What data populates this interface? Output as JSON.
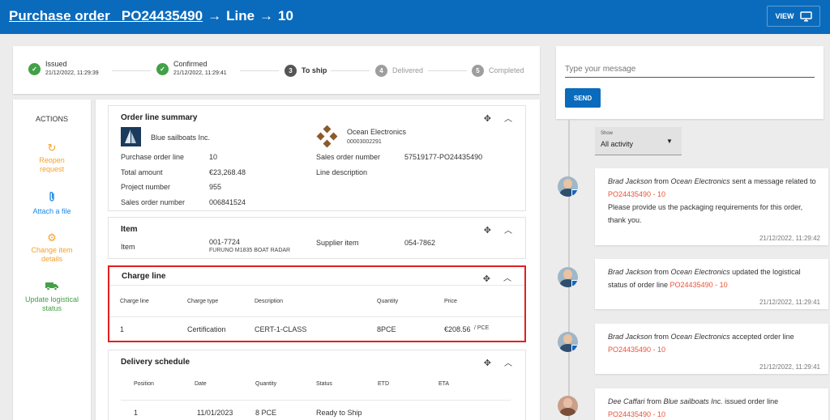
{
  "header": {
    "title_link": "Purchase order   PO24435490",
    "arrow1": "→",
    "line_label": "Line",
    "arrow2": "→",
    "line_number": "10",
    "view_label": "VIEW"
  },
  "steps": [
    {
      "num": "✓",
      "label": "Issued",
      "date": "21/12/2022, 11:29:39",
      "state": "done"
    },
    {
      "num": "✓",
      "label": "Confirmed",
      "date": "21/12/2022, 11:29:41",
      "state": "done"
    },
    {
      "num": "3",
      "label": "To ship",
      "date": "",
      "state": "current"
    },
    {
      "num": "4",
      "label": "Delivered",
      "date": "",
      "state": "todo"
    },
    {
      "num": "5",
      "label": "Completed",
      "date": "",
      "state": "todo"
    }
  ],
  "actions": {
    "title": "ACTIONS",
    "items": [
      {
        "label": "Reopen request",
        "icon": "refresh-icon"
      },
      {
        "label": "Attach a file",
        "icon": "paperclip-icon"
      },
      {
        "label": "Change item details",
        "icon": "gear-icon"
      },
      {
        "label": "Update logistical status",
        "icon": "truck-icon"
      }
    ]
  },
  "summary": {
    "title": "Order line summary",
    "buyer": "Blue sailboats Inc.",
    "supplier": "Ocean Electronics",
    "supplier_id": "00003002291",
    "left": [
      {
        "label": "Purchase order line",
        "value": "10"
      },
      {
        "label": "Total amount",
        "value": "€23,268.48"
      },
      {
        "label": "Project number",
        "value": "955"
      },
      {
        "label": "Sales order number",
        "value": "006841524"
      }
    ],
    "right": [
      {
        "label": "Sales order number",
        "value": "57519177-PO24435490"
      },
      {
        "label": "Line description",
        "value": ""
      }
    ]
  },
  "item": {
    "title": "Item",
    "label": "Item",
    "code": "001-7724",
    "desc": "FURUNO M1835 BOAT RADAR",
    "supplier_label": "Supplier item",
    "supplier_value": "054-7862"
  },
  "charge": {
    "title": "Charge line",
    "headers": [
      "Charge line",
      "Charge type",
      "Description",
      "Quantity",
      "Price"
    ],
    "row": {
      "line": "1",
      "type": "Certification",
      "desc": "CERT-1-CLASS",
      "qty": "8PCE",
      "price": "€208.56",
      "unit": "/ PCE"
    }
  },
  "delivery": {
    "title": "Delivery schedule",
    "headers": [
      "Position",
      "Date",
      "Quantity",
      "Status",
      "ETD",
      "ETA"
    ],
    "row": {
      "pos": "1",
      "date": "11/01/2023",
      "qty": "8 PCE",
      "status": "Ready to Ship",
      "etd": "",
      "eta": ""
    }
  },
  "chat": {
    "placeholder": "Type your message",
    "send": "SEND"
  },
  "filter": {
    "label": "Show",
    "value": "All activity"
  },
  "events": [
    {
      "who": "Brad Jackson",
      "mid1": " from ",
      "org": "Ocean Electronics",
      "mid2": " sent a message related to ",
      "link": "PO24435490 - 10",
      "extra": "Please provide us the packaging requirements for this order, thank you.",
      "time": "21/12/2022, 11:29:42"
    },
    {
      "who": "Brad Jackson",
      "mid1": " from ",
      "org": "Ocean Electronics",
      "mid2": " updated the logistical status of order line ",
      "link": "PO24435490 - 10",
      "extra": "",
      "time": "21/12/2022, 11:29:41"
    },
    {
      "who": "Brad Jackson",
      "mid1": " from ",
      "org": "Ocean Electronics",
      "mid2": " accepted order line ",
      "link": "PO24435490 - 10",
      "extra": "",
      "time": "21/12/2022, 11:29:41"
    },
    {
      "who": "Dee Caffari",
      "mid1": " from ",
      "org": "Blue sailboats Inc.",
      "mid2": " issued order line ",
      "link": "PO24435490 - 10",
      "extra": "",
      "time": ""
    }
  ],
  "colors": {
    "header_bg": "#0a6bbd",
    "accent": "#0a6bbd",
    "highlight": "#e02020",
    "link": "#e8533a",
    "done": "#43a047",
    "orange": "#f4a12b"
  }
}
